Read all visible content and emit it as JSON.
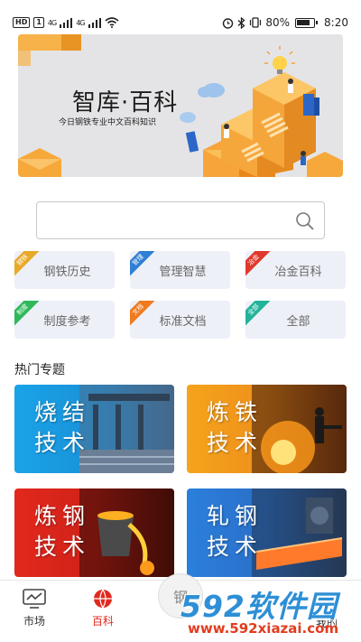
{
  "status_bar": {
    "hd_badge": "HD",
    "sim1": "1",
    "net1": "4G",
    "net2": "4G",
    "battery": "80%",
    "time": "8:20"
  },
  "banner": {
    "title": "智库·百科",
    "subtitle": "今日钢铁专业中文百科知识"
  },
  "search": {
    "value": "",
    "placeholder": ""
  },
  "categories": [
    {
      "tag": "钢铁",
      "label": "钢铁历史",
      "tag_color": "#e8a92a"
    },
    {
      "tag": "管理",
      "label": "管理智慧",
      "tag_color": "#2f7fd4"
    },
    {
      "tag": "冶金",
      "label": "冶金百科",
      "tag_color": "#e0382c"
    },
    {
      "tag": "制度",
      "label": "制度参考",
      "tag_color": "#2fb85a"
    },
    {
      "tag": "文档",
      "label": "标准文档",
      "tag_color": "#f07a1e"
    },
    {
      "tag": "全部",
      "label": "全部",
      "tag_color": "#22b39a"
    }
  ],
  "section": {
    "title": "热门专题"
  },
  "topics": [
    {
      "line1": "烧结",
      "line2": "技术",
      "color": "#1f9ee0"
    },
    {
      "line1": "炼铁",
      "line2": "技术",
      "color": "#f2a21c"
    },
    {
      "line1": "炼钢",
      "line2": "技术",
      "color": "#e12a1f"
    },
    {
      "line1": "轧钢",
      "line2": "技术",
      "color": "#2b7ad6"
    }
  ],
  "tabs": {
    "market": "市场",
    "encyclopedia": "百科",
    "center": "钢",
    "mine": "我的"
  },
  "colors": {
    "active_tab": "#e12a1f",
    "banner_orange": "#f5a23a"
  },
  "watermark": {
    "brand": "592软件园",
    "url": "www.592xiazai.com"
  }
}
